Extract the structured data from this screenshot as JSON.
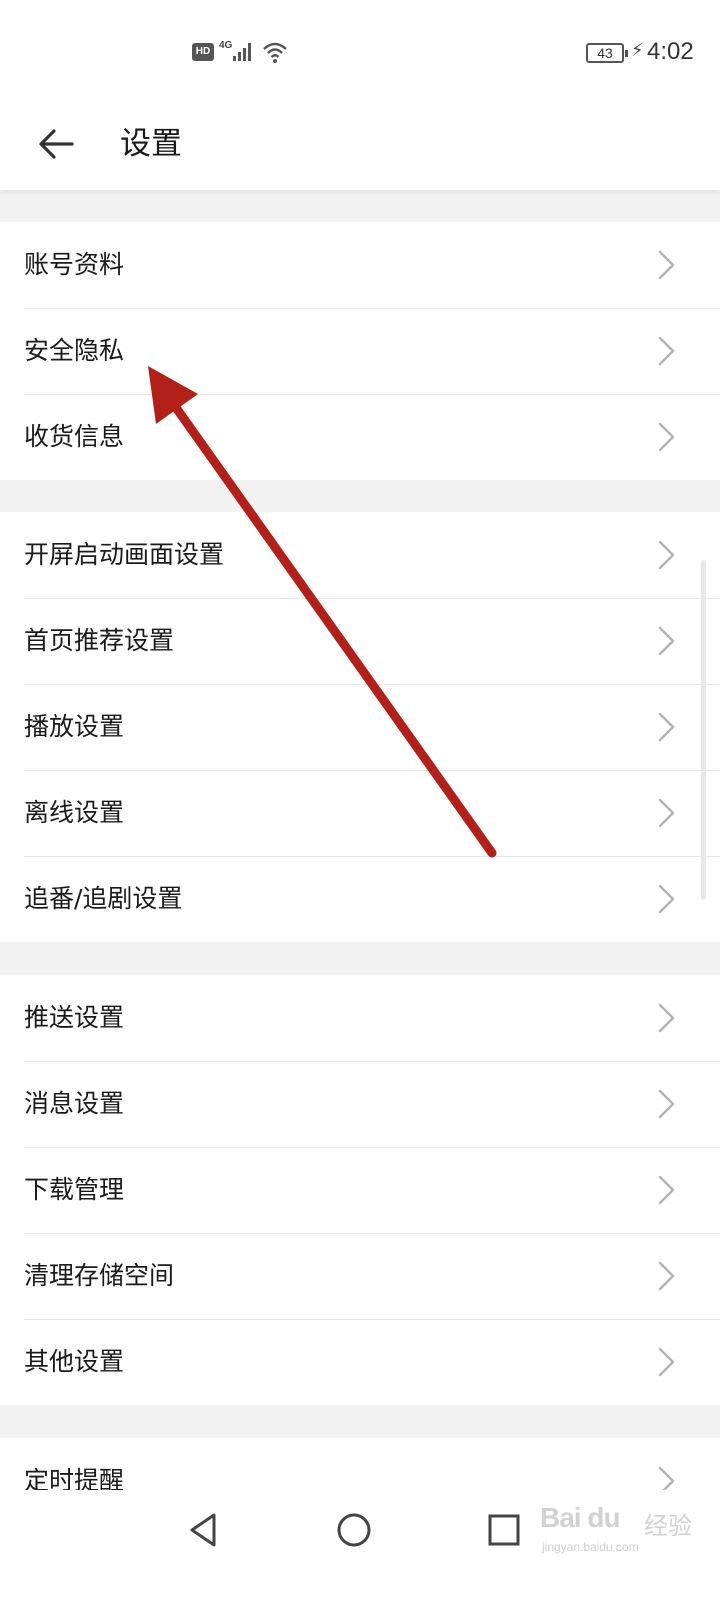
{
  "status_bar": {
    "hd_label": "HD",
    "network_label": "4G",
    "battery_level": "43",
    "time": "4:02",
    "icons": [
      "hd-icon",
      "signal-icon",
      "wifi-icon",
      "battery-icon",
      "charging-icon"
    ]
  },
  "header": {
    "back_icon": "back-arrow-icon",
    "title": "设置"
  },
  "groups": [
    {
      "items": [
        {
          "label": "账号资料"
        },
        {
          "label": "安全隐私"
        },
        {
          "label": "收货信息"
        }
      ]
    },
    {
      "items": [
        {
          "label": "开屏启动画面设置"
        },
        {
          "label": "首页推荐设置"
        },
        {
          "label": "播放设置"
        },
        {
          "label": "离线设置"
        },
        {
          "label": "追番/追剧设置"
        }
      ]
    },
    {
      "items": [
        {
          "label": "推送设置"
        },
        {
          "label": "消息设置"
        },
        {
          "label": "下载管理"
        },
        {
          "label": "清理存储空间"
        },
        {
          "label": "其他设置"
        }
      ]
    },
    {
      "items": [
        {
          "label": "定时提醒"
        }
      ]
    }
  ],
  "nav_bar": {
    "icons": [
      "nav-back-icon",
      "nav-home-icon",
      "nav-recent-icon"
    ]
  },
  "watermark": {
    "logo": "Bai du",
    "text": "经验",
    "url": "jingyan.baidu.com"
  },
  "colors": {
    "background": "#f2f2f2",
    "surface": "#ffffff",
    "divider": "#e6e6e6",
    "chevron": "#b3b3b3",
    "annotation_arrow": "#b3201a"
  }
}
